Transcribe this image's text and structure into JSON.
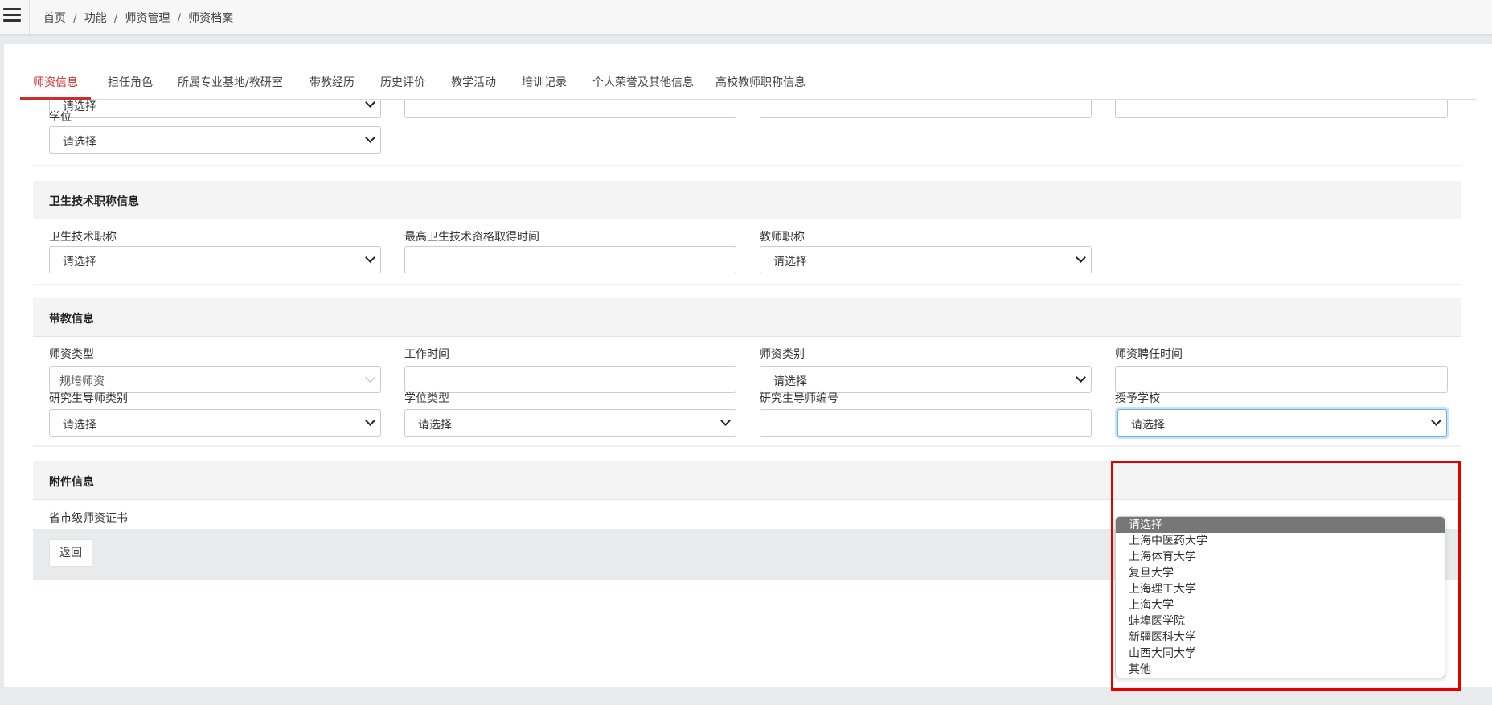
{
  "breadcrumb": [
    "首页",
    "功能",
    "师资管理",
    "师资档案"
  ],
  "tabs": [
    {
      "label": "师资信息",
      "active": true
    },
    {
      "label": "担任角色"
    },
    {
      "label": "所属专业基地/教研室"
    },
    {
      "label": "带教经历"
    },
    {
      "label": "历史评价"
    },
    {
      "label": "教学活动"
    },
    {
      "label": "培训记录"
    },
    {
      "label": "个人荣誉及其他信息"
    },
    {
      "label": "高校教师职称信息"
    }
  ],
  "top_partial": {
    "select_placeholder": "请选择",
    "degree_label": "学位",
    "degree_value": "请选择"
  },
  "health_section": {
    "title": "卫生技术职称信息",
    "health_title_label": "卫生技术职称",
    "health_title_value": "请选择",
    "qual_time_label": "最高卫生技术资格取得时间",
    "qual_time_value": "",
    "teacher_title_label": "教师职称",
    "teacher_title_value": "请选择"
  },
  "teaching_section": {
    "title": "带教信息",
    "faculty_type_label": "师资类型",
    "faculty_type_value": "规培师资",
    "work_time_label": "工作时间",
    "work_time_value": "",
    "faculty_category_label": "师资类别",
    "faculty_category_value": "请选择",
    "appoint_time_label": "师资聘任时间",
    "appoint_time_value": "",
    "supervisor_type_label": "研究生导师类别",
    "supervisor_type_value": "请选择",
    "degree_type_label": "学位类型",
    "degree_type_value": "请选择",
    "supervisor_no_label": "研究生导师编号",
    "supervisor_no_value": "",
    "school_label": "授予学校",
    "school_value": "请选择"
  },
  "attachment_section": {
    "title": "附件信息",
    "cert_label": "省市级师资证书"
  },
  "footer": {
    "back_label": "返回"
  },
  "school_options": [
    "请选择",
    "上海中医药大学",
    "上海体育大学",
    "复旦大学",
    "上海理工大学",
    "上海大学",
    "蚌埠医学院",
    "新疆医科大学",
    "山西大同大学",
    "其他"
  ],
  "colors": {
    "accent": "#c9302c",
    "highlight": "#e30000",
    "selected_option": "#777777"
  }
}
